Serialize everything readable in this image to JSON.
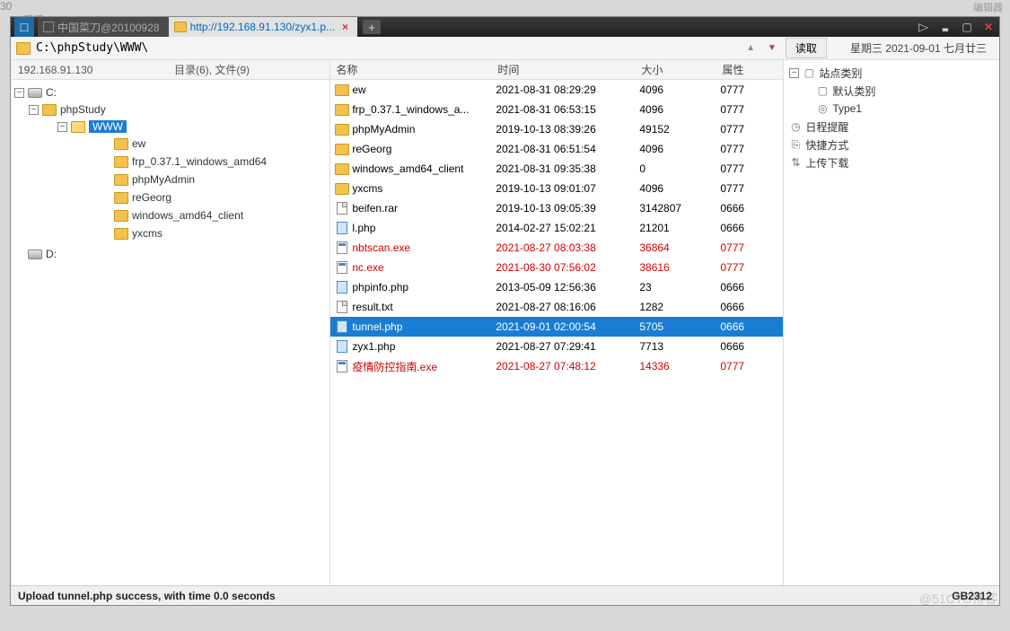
{
  "tabs": {
    "inactive": "中国菜刀@20100928",
    "active": "http://192.168.91.130/zyx1.p..."
  },
  "path": "C:\\phpStudy\\WWW\\",
  "read_button": "读取",
  "date_text": "星期三 2021-09-01 七月廿三",
  "tree_header": {
    "ip": "192.168.91.130",
    "stats": "目录(6), 文件(9)"
  },
  "tree": {
    "c": "C:",
    "phpStudy": "phpStudy",
    "www": "WWW",
    "children": [
      "ew",
      "frp_0.37.1_windows_amd64",
      "phpMyAdmin",
      "reGeorg",
      "windows_amd64_client",
      "yxcms"
    ],
    "d": "D:"
  },
  "columns": {
    "name": "名称",
    "time": "时间",
    "size": "大小",
    "attr": "属性"
  },
  "files": [
    {
      "icon": "folder",
      "name": "ew",
      "time": "2021-08-31 08:29:29",
      "size": "4096",
      "attr": "0777",
      "cls": ""
    },
    {
      "icon": "folder",
      "name": "frp_0.37.1_windows_a...",
      "time": "2021-08-31 06:53:15",
      "size": "4096",
      "attr": "0777",
      "cls": ""
    },
    {
      "icon": "folder",
      "name": "phpMyAdmin",
      "time": "2019-10-13 08:39:26",
      "size": "49152",
      "attr": "0777",
      "cls": ""
    },
    {
      "icon": "folder",
      "name": "reGeorg",
      "time": "2021-08-31 06:51:54",
      "size": "4096",
      "attr": "0777",
      "cls": ""
    },
    {
      "icon": "folder",
      "name": "windows_amd64_client",
      "time": "2021-08-31 09:35:38",
      "size": "0",
      "attr": "0777",
      "cls": ""
    },
    {
      "icon": "folder",
      "name": "yxcms",
      "time": "2019-10-13 09:01:07",
      "size": "4096",
      "attr": "0777",
      "cls": ""
    },
    {
      "icon": "file",
      "name": "beifen.rar",
      "time": "2019-10-13 09:05:39",
      "size": "3142807",
      "attr": "0666",
      "cls": ""
    },
    {
      "icon": "php",
      "name": "l.php",
      "time": "2014-02-27 15:02:21",
      "size": "21201",
      "attr": "0666",
      "cls": ""
    },
    {
      "icon": "exe",
      "name": "nbtscan.exe",
      "time": "2021-08-27 08:03:38",
      "size": "36864",
      "attr": "0777",
      "cls": "red"
    },
    {
      "icon": "exe",
      "name": "nc.exe",
      "time": "2021-08-30 07:56:02",
      "size": "38616",
      "attr": "0777",
      "cls": "red"
    },
    {
      "icon": "php",
      "name": "phpinfo.php",
      "time": "2013-05-09 12:56:36",
      "size": "23",
      "attr": "0666",
      "cls": ""
    },
    {
      "icon": "file",
      "name": "result.txt",
      "time": "2021-08-27 08:16:06",
      "size": "1282",
      "attr": "0666",
      "cls": ""
    },
    {
      "icon": "php",
      "name": "tunnel.php",
      "time": "2021-09-01 02:00:54",
      "size": "5705",
      "attr": "0666",
      "cls": "sel"
    },
    {
      "icon": "php",
      "name": "zyx1.php",
      "time": "2021-08-27 07:29:41",
      "size": "7713",
      "attr": "0666",
      "cls": ""
    },
    {
      "icon": "exe",
      "name": "疫情防控指南.exe",
      "time": "2021-08-27 07:48:12",
      "size": "14336",
      "attr": "0777",
      "cls": "red"
    }
  ],
  "rightpanel": {
    "site": "站点类别",
    "default": "默认类别",
    "type1": "Type1",
    "schedule": "日程提醒",
    "shortcut": "快捷方式",
    "updown": "上传下载"
  },
  "status": "Upload tunnel.php success, with time 0.0 seconds",
  "encoding": "GB2312",
  "watermark": "@51CTO博客",
  "topedge": {
    "a": "30",
    "b": "} 看看/"
  }
}
